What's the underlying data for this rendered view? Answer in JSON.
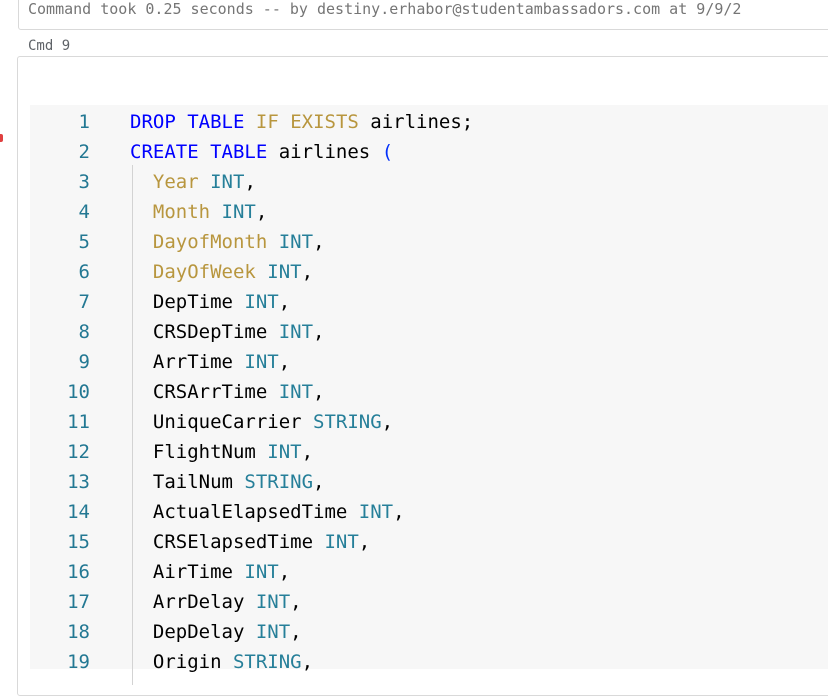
{
  "previous_cell": {
    "status": "Command took 0.25 seconds -- by destiny.erhabor@studentambassadors.com at 9/9/2"
  },
  "cell": {
    "label": "Cmd 9"
  },
  "code_lines": [
    {
      "number": "1",
      "tokens": [
        {
          "t": "DROP",
          "c": "kw"
        },
        {
          "t": " ",
          "c": ""
        },
        {
          "t": "TABLE",
          "c": "kw"
        },
        {
          "t": " ",
          "c": ""
        },
        {
          "t": "IF",
          "c": "ident-kw"
        },
        {
          "t": " ",
          "c": ""
        },
        {
          "t": "EXISTS",
          "c": "ident-kw"
        },
        {
          "t": " airlines;",
          "c": "punc"
        }
      ]
    },
    {
      "number": "2",
      "tokens": [
        {
          "t": "CREATE",
          "c": "kw"
        },
        {
          "t": " ",
          "c": ""
        },
        {
          "t": "TABLE",
          "c": "kw"
        },
        {
          "t": " airlines ",
          "c": "punc"
        },
        {
          "t": "(",
          "c": "paren"
        }
      ]
    },
    {
      "number": "3",
      "tokens": [
        {
          "t": "  ",
          "c": ""
        },
        {
          "t": "Year",
          "c": "ident-kw"
        },
        {
          "t": " ",
          "c": ""
        },
        {
          "t": "INT",
          "c": "type"
        },
        {
          "t": ",",
          "c": "punc"
        }
      ]
    },
    {
      "number": "4",
      "tokens": [
        {
          "t": "  ",
          "c": ""
        },
        {
          "t": "Month",
          "c": "ident-kw"
        },
        {
          "t": " ",
          "c": ""
        },
        {
          "t": "INT",
          "c": "type"
        },
        {
          "t": ",",
          "c": "punc"
        }
      ]
    },
    {
      "number": "5",
      "tokens": [
        {
          "t": "  ",
          "c": ""
        },
        {
          "t": "DayofMonth",
          "c": "ident-kw"
        },
        {
          "t": " ",
          "c": ""
        },
        {
          "t": "INT",
          "c": "type"
        },
        {
          "t": ",",
          "c": "punc"
        }
      ]
    },
    {
      "number": "6",
      "tokens": [
        {
          "t": "  ",
          "c": ""
        },
        {
          "t": "DayOfWeek",
          "c": "ident-kw"
        },
        {
          "t": " ",
          "c": ""
        },
        {
          "t": "INT",
          "c": "type"
        },
        {
          "t": ",",
          "c": "punc"
        }
      ]
    },
    {
      "number": "7",
      "tokens": [
        {
          "t": "  DepTime ",
          "c": "punc"
        },
        {
          "t": "INT",
          "c": "type"
        },
        {
          "t": ",",
          "c": "punc"
        }
      ]
    },
    {
      "number": "8",
      "tokens": [
        {
          "t": "  CRSDepTime ",
          "c": "punc"
        },
        {
          "t": "INT",
          "c": "type"
        },
        {
          "t": ",",
          "c": "punc"
        }
      ]
    },
    {
      "number": "9",
      "tokens": [
        {
          "t": "  ArrTime ",
          "c": "punc"
        },
        {
          "t": "INT",
          "c": "type"
        },
        {
          "t": ",",
          "c": "punc"
        }
      ]
    },
    {
      "number": "10",
      "tokens": [
        {
          "t": "  CRSArrTime ",
          "c": "punc"
        },
        {
          "t": "INT",
          "c": "type"
        },
        {
          "t": ",",
          "c": "punc"
        }
      ]
    },
    {
      "number": "11",
      "tokens": [
        {
          "t": "  UniqueCarrier ",
          "c": "punc"
        },
        {
          "t": "STRING",
          "c": "type"
        },
        {
          "t": ",",
          "c": "punc"
        }
      ]
    },
    {
      "number": "12",
      "tokens": [
        {
          "t": "  FlightNum ",
          "c": "punc"
        },
        {
          "t": "INT",
          "c": "type"
        },
        {
          "t": ",",
          "c": "punc"
        }
      ]
    },
    {
      "number": "13",
      "tokens": [
        {
          "t": "  TailNum ",
          "c": "punc"
        },
        {
          "t": "STRING",
          "c": "type"
        },
        {
          "t": ",",
          "c": "punc"
        }
      ]
    },
    {
      "number": "14",
      "tokens": [
        {
          "t": "  ActualElapsedTime ",
          "c": "punc"
        },
        {
          "t": "INT",
          "c": "type"
        },
        {
          "t": ",",
          "c": "punc"
        }
      ]
    },
    {
      "number": "15",
      "tokens": [
        {
          "t": "  CRSElapsedTime ",
          "c": "punc"
        },
        {
          "t": "INT",
          "c": "type"
        },
        {
          "t": ",",
          "c": "punc"
        }
      ]
    },
    {
      "number": "16",
      "tokens": [
        {
          "t": "  AirTime ",
          "c": "punc"
        },
        {
          "t": "INT",
          "c": "type"
        },
        {
          "t": ",",
          "c": "punc"
        }
      ]
    },
    {
      "number": "17",
      "tokens": [
        {
          "t": "  ArrDelay ",
          "c": "punc"
        },
        {
          "t": "INT",
          "c": "type"
        },
        {
          "t": ",",
          "c": "punc"
        }
      ]
    },
    {
      "number": "18",
      "tokens": [
        {
          "t": "  DepDelay ",
          "c": "punc"
        },
        {
          "t": "INT",
          "c": "type"
        },
        {
          "t": ",",
          "c": "punc"
        }
      ]
    },
    {
      "number": "19",
      "tokens": [
        {
          "t": "  Origin ",
          "c": "punc"
        },
        {
          "t": "STRING",
          "c": "type"
        },
        {
          "t": ",",
          "c": "punc"
        }
      ]
    }
  ]
}
